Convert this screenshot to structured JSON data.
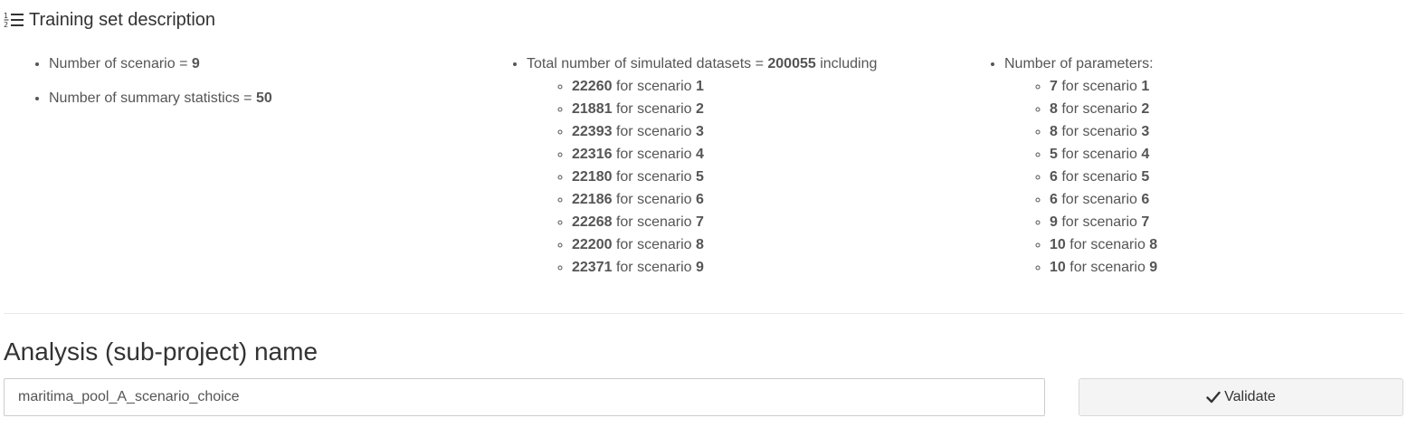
{
  "section": {
    "title": "Training set description",
    "icon": "ordered-list-icon"
  },
  "col1": {
    "items": [
      {
        "label": "Number of scenario = ",
        "value": "9"
      },
      {
        "label": "Number of summary statistics = ",
        "value": "50"
      }
    ]
  },
  "col2": {
    "header": {
      "prefix": "Total number of simulated datasets = ",
      "value": "200055",
      "suffix": " including"
    },
    "items": [
      {
        "count": "22260",
        "mid": " for scenario ",
        "scenario": "1"
      },
      {
        "count": "21881",
        "mid": " for scenario ",
        "scenario": "2"
      },
      {
        "count": "22393",
        "mid": " for scenario ",
        "scenario": "3"
      },
      {
        "count": "22316",
        "mid": " for scenario ",
        "scenario": "4"
      },
      {
        "count": "22180",
        "mid": " for scenario ",
        "scenario": "5"
      },
      {
        "count": "22186",
        "mid": " for scenario ",
        "scenario": "6"
      },
      {
        "count": "22268",
        "mid": " for scenario ",
        "scenario": "7"
      },
      {
        "count": "22200",
        "mid": " for scenario ",
        "scenario": "8"
      },
      {
        "count": "22371",
        "mid": " for scenario ",
        "scenario": "9"
      }
    ]
  },
  "col3": {
    "header": "Number of parameters:",
    "items": [
      {
        "count": "7",
        "mid": " for scenario ",
        "scenario": "1"
      },
      {
        "count": "8",
        "mid": " for scenario ",
        "scenario": "2"
      },
      {
        "count": "8",
        "mid": " for scenario ",
        "scenario": "3"
      },
      {
        "count": "5",
        "mid": " for scenario ",
        "scenario": "4"
      },
      {
        "count": "6",
        "mid": " for scenario ",
        "scenario": "5"
      },
      {
        "count": "6",
        "mid": " for scenario ",
        "scenario": "6"
      },
      {
        "count": "9",
        "mid": " for scenario ",
        "scenario": "7"
      },
      {
        "count": "10",
        "mid": " for scenario ",
        "scenario": "8"
      },
      {
        "count": "10",
        "mid": " for scenario ",
        "scenario": "9"
      }
    ]
  },
  "analysis": {
    "title": "Analysis (sub-project) name",
    "input_value": "maritima_pool_A_scenario_choice",
    "validate_label": "Validate",
    "validate_icon": "check-icon"
  }
}
